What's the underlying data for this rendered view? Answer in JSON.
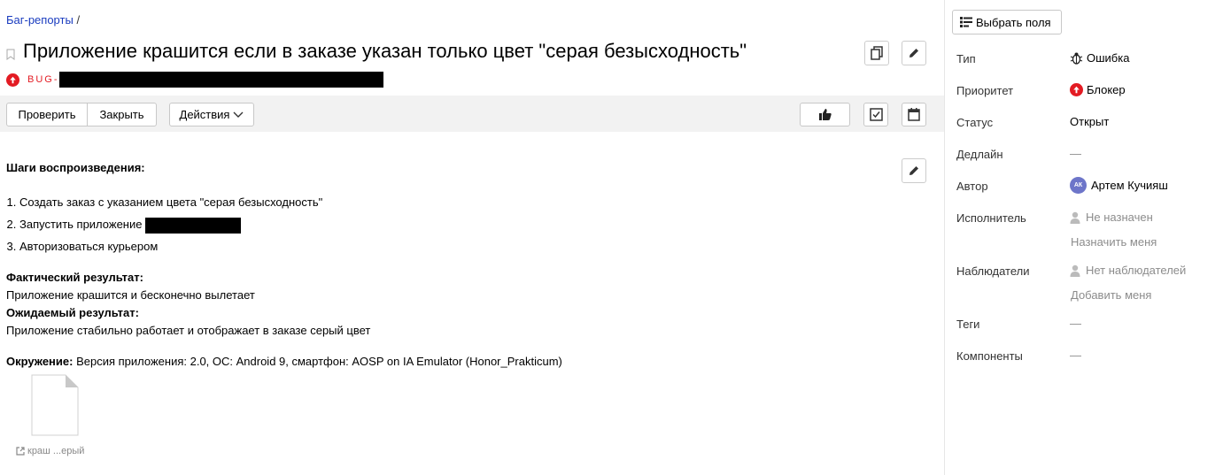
{
  "breadcrumb": {
    "queue": "Баг-репорты",
    "separator": "/"
  },
  "issue": {
    "title": "Приложение крашится если в заказе указан только цвет \"серая безысходность\"",
    "key_prefix": "BUG-"
  },
  "toolbar": {
    "check_label": "Проверить",
    "close_label": "Закрыть",
    "actions_label": "Действия"
  },
  "description": {
    "steps_heading": "Шаги воспроизведения:",
    "steps": [
      "Создать заказ с указанием цвета \"серая безысходность\"",
      "Запустить приложение",
      "Авторизоваться курьером"
    ],
    "actual_heading": "Фактический результат:",
    "actual_text": "Приложение крашится и бесконечно вылетает",
    "expected_heading": "Ожидаемый результат:",
    "expected_text": "Приложение стабильно работает и отображает в заказе серый цвет",
    "env_heading": "Окружение:",
    "env_text": " Версия приложения: 2.0, ОС: Android 9, смартфон: AOSP on IA Emulator (Honor_Prakticum)"
  },
  "attachment": {
    "name": "краш ...ерый"
  },
  "sidebar": {
    "select_fields_label": "Выбрать поля",
    "type_label": "Тип",
    "type_value": "Ошибка",
    "priority_label": "Приоритет",
    "priority_value": "Блокер",
    "status_label": "Статус",
    "status_value": "Открыт",
    "deadline_label": "Дедлайн",
    "deadline_value": "—",
    "author_label": "Автор",
    "author_initials": "АК",
    "author_value": "Артем Кучияш",
    "assignee_label": "Исполнитель",
    "assignee_value": "Не назначен",
    "assign_me": "Назначить меня",
    "followers_label": "Наблюдатели",
    "followers_value": "Нет наблюдателей",
    "add_me": "Добавить меня",
    "tags_label": "Теги",
    "tags_value": "—",
    "components_label": "Компоненты",
    "components_value": "—"
  },
  "colors": {
    "accent": "#1a3cbf",
    "blocker": "#e31b23",
    "toolbar_bg": "#f2f2f2",
    "avatar": "#6d75c9"
  }
}
